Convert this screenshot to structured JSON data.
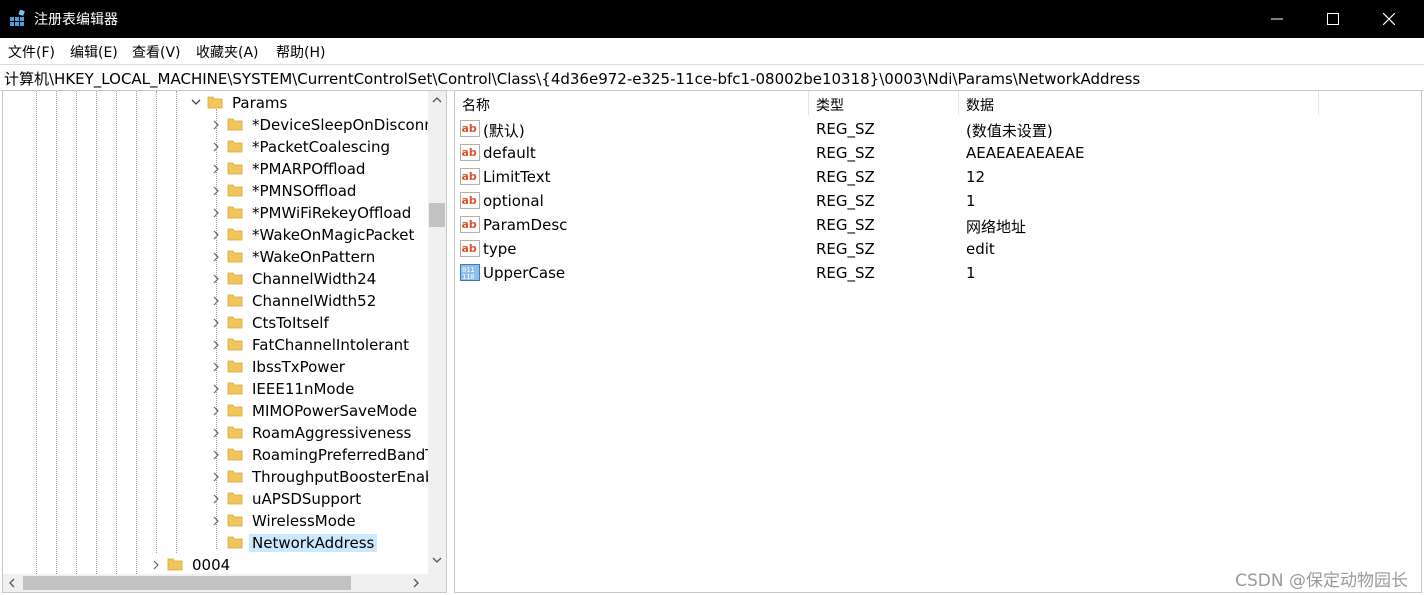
{
  "window": {
    "title": "注册表编辑器",
    "minimize_icon": "minimize-icon",
    "maximize_icon": "maximize-icon",
    "close_icon": "close-icon"
  },
  "menu": [
    "文件(F)",
    "编辑(E)",
    "查看(V)",
    "收藏夹(A)",
    "帮助(H)"
  ],
  "address": "计算机\\HKEY_LOCAL_MACHINE\\SYSTEM\\CurrentControlSet\\Control\\Class\\{4d36e972-e325-11ce-bfc1-08002be10318}\\0003\\Ndi\\Params\\NetworkAddress",
  "tree": {
    "parent": "Params",
    "items": [
      "*DeviceSleepOnDisconn",
      "*PacketCoalescing",
      "*PMARPOffload",
      "*PMNSOffload",
      "*PMWiFiRekeyOffload",
      "*WakeOnMagicPacket",
      "*WakeOnPattern",
      "ChannelWidth24",
      "ChannelWidth52",
      "CtsToItself",
      "FatChannelIntolerant",
      "IbssTxPower",
      "IEEE11nMode",
      "MIMOPowerSaveMode",
      "RoamAggressiveness",
      "RoamingPreferredBandT",
      "ThroughputBoosterEnab",
      "uAPSDSupport",
      "WirelessMode"
    ],
    "selected": "NetworkAddress",
    "next_sibling": "0004"
  },
  "list": {
    "headers": {
      "name": "名称",
      "type": "类型",
      "data": "数据"
    },
    "rows": [
      {
        "name": "(默认)",
        "type": "REG_SZ",
        "data": "(数值未设置)",
        "icon": "string-value-icon"
      },
      {
        "name": "default",
        "type": "REG_SZ",
        "data": "AEAEAEAEAEAE",
        "icon": "string-value-icon"
      },
      {
        "name": "LimitText",
        "type": "REG_SZ",
        "data": "12",
        "icon": "string-value-icon"
      },
      {
        "name": "optional",
        "type": "REG_SZ",
        "data": "1",
        "icon": "string-value-icon"
      },
      {
        "name": "ParamDesc",
        "type": "REG_SZ",
        "data": "网络地址",
        "icon": "string-value-icon"
      },
      {
        "name": "type",
        "type": "REG_SZ",
        "data": "edit",
        "icon": "string-value-icon"
      },
      {
        "name": "UpperCase",
        "type": "REG_SZ",
        "data": "1",
        "icon": "binary-value-icon"
      }
    ]
  },
  "watermark": "CSDN @保定动物园长",
  "colors": {
    "titlebar": "#000000",
    "selection": "#cce8ff",
    "folder": "#f2c55c",
    "ab_icon": "#d9532c"
  }
}
